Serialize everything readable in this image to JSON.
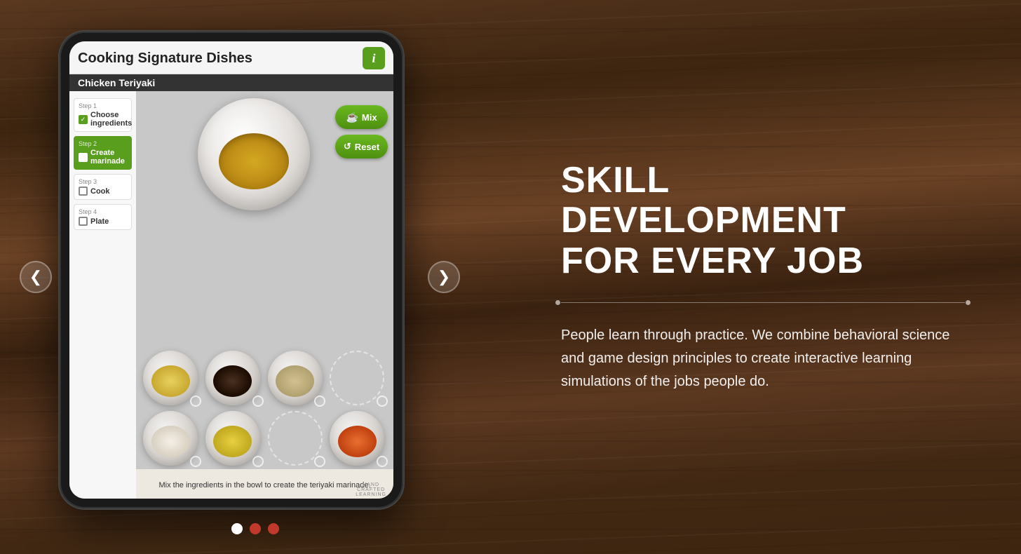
{
  "background": {
    "color": "#3d2510"
  },
  "tablet": {
    "app_title": "Cooking Signature Dishes",
    "info_button_label": "i",
    "dish_name": "Chicken Teriyaki",
    "steps": [
      {
        "id": 1,
        "label": "Step 1",
        "name": "Choose ingredients",
        "checked": true,
        "active": false
      },
      {
        "id": 2,
        "label": "Step 2",
        "name": "Create marinade",
        "checked": false,
        "active": true
      },
      {
        "id": 3,
        "label": "Step 3",
        "name": "Cook",
        "checked": false,
        "active": false
      },
      {
        "id": 4,
        "label": "Step 4",
        "name": "Plate",
        "checked": false,
        "active": false
      }
    ],
    "buttons": {
      "mix": "Mix",
      "reset": "Reset"
    },
    "instruction": "Mix the ingredients in the bowl to create the teriyaki marinade.",
    "logo": "HANDCRAFTED\nLEARNING"
  },
  "navigation": {
    "left_arrow": "❮",
    "right_arrow": "❯"
  },
  "pagination": {
    "dots": [
      "white",
      "red",
      "red"
    ]
  },
  "right_panel": {
    "heading_line1": "SKILL DEVELOPMENT",
    "heading_line2": "FOR EVERY JOB",
    "description": "People learn through practice. We combine behavioral science and game design principles to create interactive learning simulations of the jobs people do."
  }
}
